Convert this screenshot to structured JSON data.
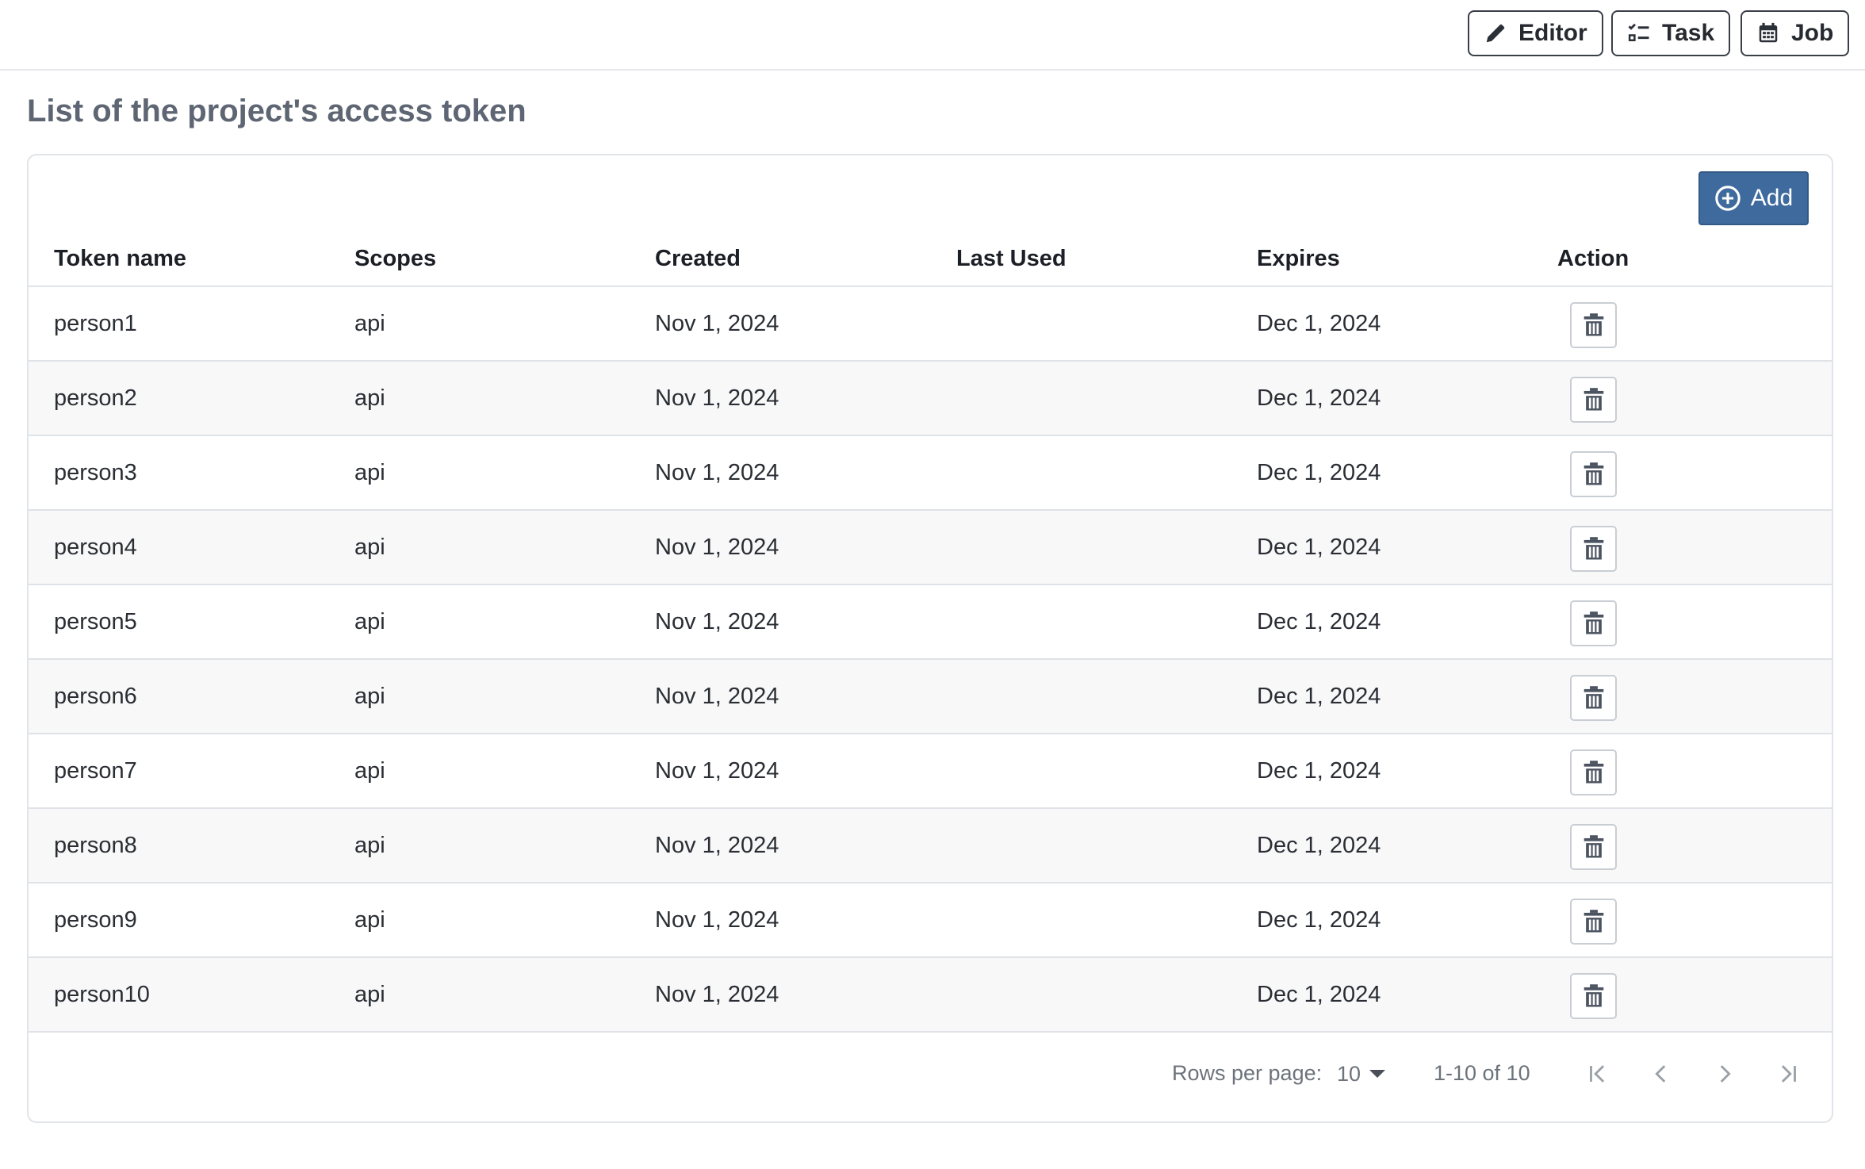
{
  "toolbar": {
    "editor_label": "Editor",
    "task_label": "Task",
    "job_label": "Job"
  },
  "page": {
    "title": "List of the project's access token"
  },
  "table": {
    "add_label": "Add",
    "columns": [
      "Token name",
      "Scopes",
      "Created",
      "Last Used",
      "Expires",
      "Action"
    ],
    "rows": [
      {
        "name": "person1",
        "scopes": "api",
        "created": "Nov 1, 2024",
        "last_used": "",
        "expires": "Dec 1, 2024"
      },
      {
        "name": "person2",
        "scopes": "api",
        "created": "Nov 1, 2024",
        "last_used": "",
        "expires": "Dec 1, 2024"
      },
      {
        "name": "person3",
        "scopes": "api",
        "created": "Nov 1, 2024",
        "last_used": "",
        "expires": "Dec 1, 2024"
      },
      {
        "name": "person4",
        "scopes": "api",
        "created": "Nov 1, 2024",
        "last_used": "",
        "expires": "Dec 1, 2024"
      },
      {
        "name": "person5",
        "scopes": "api",
        "created": "Nov 1, 2024",
        "last_used": "",
        "expires": "Dec 1, 2024"
      },
      {
        "name": "person6",
        "scopes": "api",
        "created": "Nov 1, 2024",
        "last_used": "",
        "expires": "Dec 1, 2024"
      },
      {
        "name": "person7",
        "scopes": "api",
        "created": "Nov 1, 2024",
        "last_used": "",
        "expires": "Dec 1, 2024"
      },
      {
        "name": "person8",
        "scopes": "api",
        "created": "Nov 1, 2024",
        "last_used": "",
        "expires": "Dec 1, 2024"
      },
      {
        "name": "person9",
        "scopes": "api",
        "created": "Nov 1, 2024",
        "last_used": "",
        "expires": "Dec 1, 2024"
      },
      {
        "name": "person10",
        "scopes": "api",
        "created": "Nov 1, 2024",
        "last_used": "",
        "expires": "Dec 1, 2024"
      }
    ],
    "row_action_icon": "trash-icon"
  },
  "pagination": {
    "rows_per_page_label": "Rows per page:",
    "rows_per_page_value": "10",
    "range_text": "1-10 of 10"
  },
  "colors": {
    "primary": "#3f6a9e",
    "title_text": "#5f6673",
    "row_alt_bg": "#f8f8f8"
  }
}
